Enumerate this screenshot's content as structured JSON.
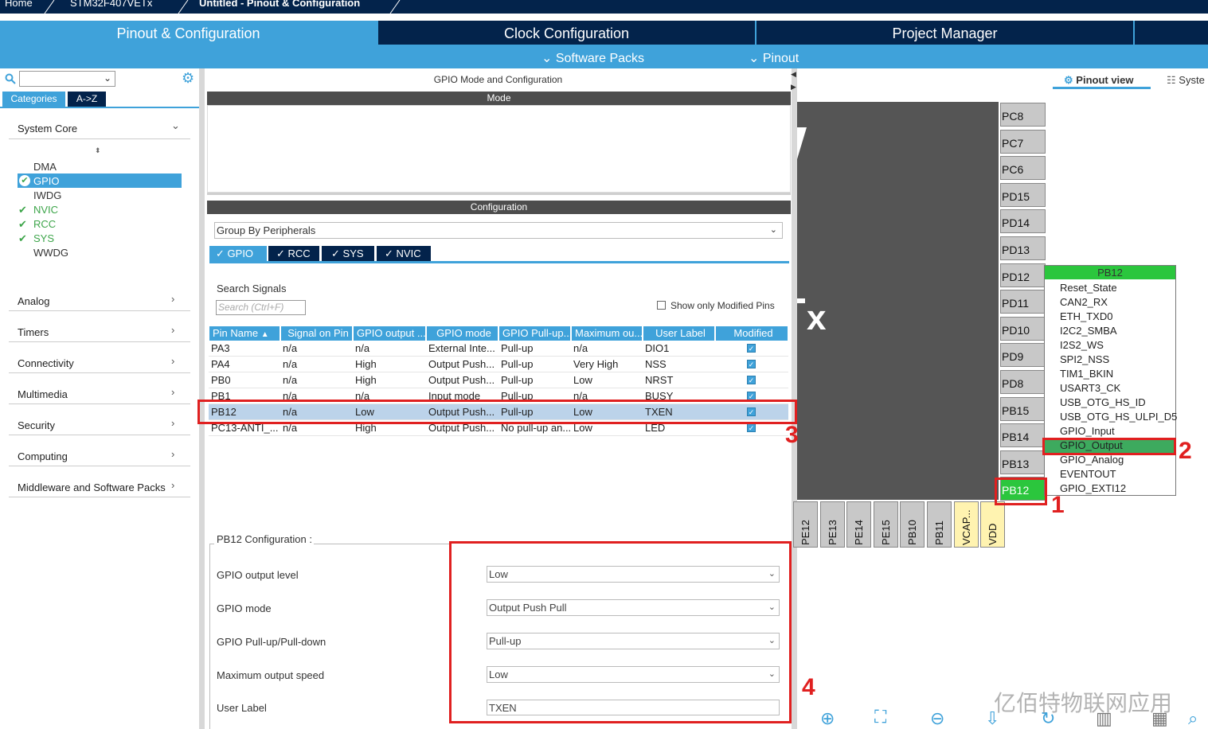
{
  "breadcrumb": {
    "home": "Home",
    "device": "STM32F407VETx",
    "project": "Untitled - Pinout & Configuration"
  },
  "tabs": [
    {
      "label": "Pinout & Configuration"
    },
    {
      "label": "Clock Configuration"
    },
    {
      "label": "Project Manager"
    }
  ],
  "subbar": {
    "software_packs": "Software Packs",
    "pinout": "Pinout"
  },
  "left": {
    "search_placeholder": "",
    "tab_categories": "Categories",
    "tab_az": "A->Z",
    "system_core": "System Core",
    "sub_items": [
      {
        "label": "DMA",
        "checked": false
      },
      {
        "label": "GPIO",
        "checked": true,
        "selected": true
      },
      {
        "label": "IWDG",
        "checked": false
      },
      {
        "label": "NVIC",
        "checked": true
      },
      {
        "label": "RCC",
        "checked": true
      },
      {
        "label": "SYS",
        "checked": true
      },
      {
        "label": "WWDG",
        "checked": false
      }
    ],
    "categories": [
      "Analog",
      "Timers",
      "Connectivity",
      "Multimedia",
      "Security",
      "Computing",
      "Middleware and Software Packs"
    ]
  },
  "center": {
    "title": "GPIO Mode and Configuration",
    "mode_header": "Mode",
    "config_header": "Configuration",
    "group_by": "Group By Peripherals",
    "peripheral_tabs": [
      "GPIO",
      "RCC",
      "SYS",
      "NVIC"
    ],
    "search_label": "Search Signals",
    "search_placeholder": "Search (Ctrl+F)",
    "show_modified": "Show only Modified Pins",
    "columns": [
      "Pin Name",
      "Signal on Pin",
      "GPIO output ...",
      "GPIO mode",
      "GPIO Pull-up...",
      "Maximum ou...",
      "User Label",
      "Modified"
    ],
    "rows": [
      [
        "PA3",
        "n/a",
        "n/a",
        "External Inte...",
        "Pull-up",
        "n/a",
        "DIO1"
      ],
      [
        "PA4",
        "n/a",
        "High",
        "Output Push...",
        "Pull-up",
        "Very High",
        "NSS"
      ],
      [
        "PB0",
        "n/a",
        "High",
        "Output Push...",
        "Pull-up",
        "Low",
        "NRST"
      ],
      [
        "PB1",
        "n/a",
        "n/a",
        "Input mode",
        "Pull-up",
        "n/a",
        "BUSY"
      ],
      [
        "PB12",
        "n/a",
        "Low",
        "Output Push...",
        "Pull-up",
        "Low",
        "TXEN"
      ],
      [
        "PC13-ANTI_...",
        "n/a",
        "High",
        "Output Push...",
        "No pull-up an...",
        "Low",
        "LED"
      ]
    ],
    "pb12_config_title": "PB12 Configuration :",
    "config_fields": [
      {
        "label": "GPIO output level",
        "value": "Low"
      },
      {
        "label": "GPIO mode",
        "value": "Output Push Pull"
      },
      {
        "label": "GPIO Pull-up/Pull-down",
        "value": "Pull-up"
      },
      {
        "label": "Maximum output speed",
        "value": "Low"
      },
      {
        "label": "User Label",
        "value": "TXEN"
      }
    ]
  },
  "right": {
    "pinout_view": "Pinout view",
    "system_view": "Syste",
    "chip_suffix": "x",
    "right_pins": [
      "PC8",
      "PC7",
      "PC6",
      "PD15",
      "PD14",
      "PD13",
      "PD12",
      "PD11",
      "PD10",
      "PD9",
      "PD8",
      "PB15",
      "PB14",
      "PB13",
      "PB12"
    ],
    "bottom_pins": [
      "PE12",
      "PE13",
      "PE14",
      "PE15",
      "PB10",
      "PB11",
      "VCAP...",
      "VDD"
    ],
    "menu_title": "PB12",
    "menu_items": [
      "Reset_State",
      "CAN2_RX",
      "ETH_TXD0",
      "I2C2_SMBA",
      "I2S2_WS",
      "SPI2_NSS",
      "TIM1_BKIN",
      "USART3_CK",
      "USB_OTG_HS_ID",
      "USB_OTG_HS_ULPI_D5",
      "GPIO_Input",
      "GPIO_Output",
      "GPIO_Analog",
      "EVENTOUT",
      "GPIO_EXTI12"
    ]
  },
  "annotations": {
    "n1": "1",
    "n2": "2",
    "n3": "3",
    "n4": "4"
  },
  "watermark": "亿佰特物联网应用",
  "colors": {
    "accent": "#3fa2da",
    "dark": "#03234b",
    "green": "#3da54a",
    "red": "#e02020"
  }
}
